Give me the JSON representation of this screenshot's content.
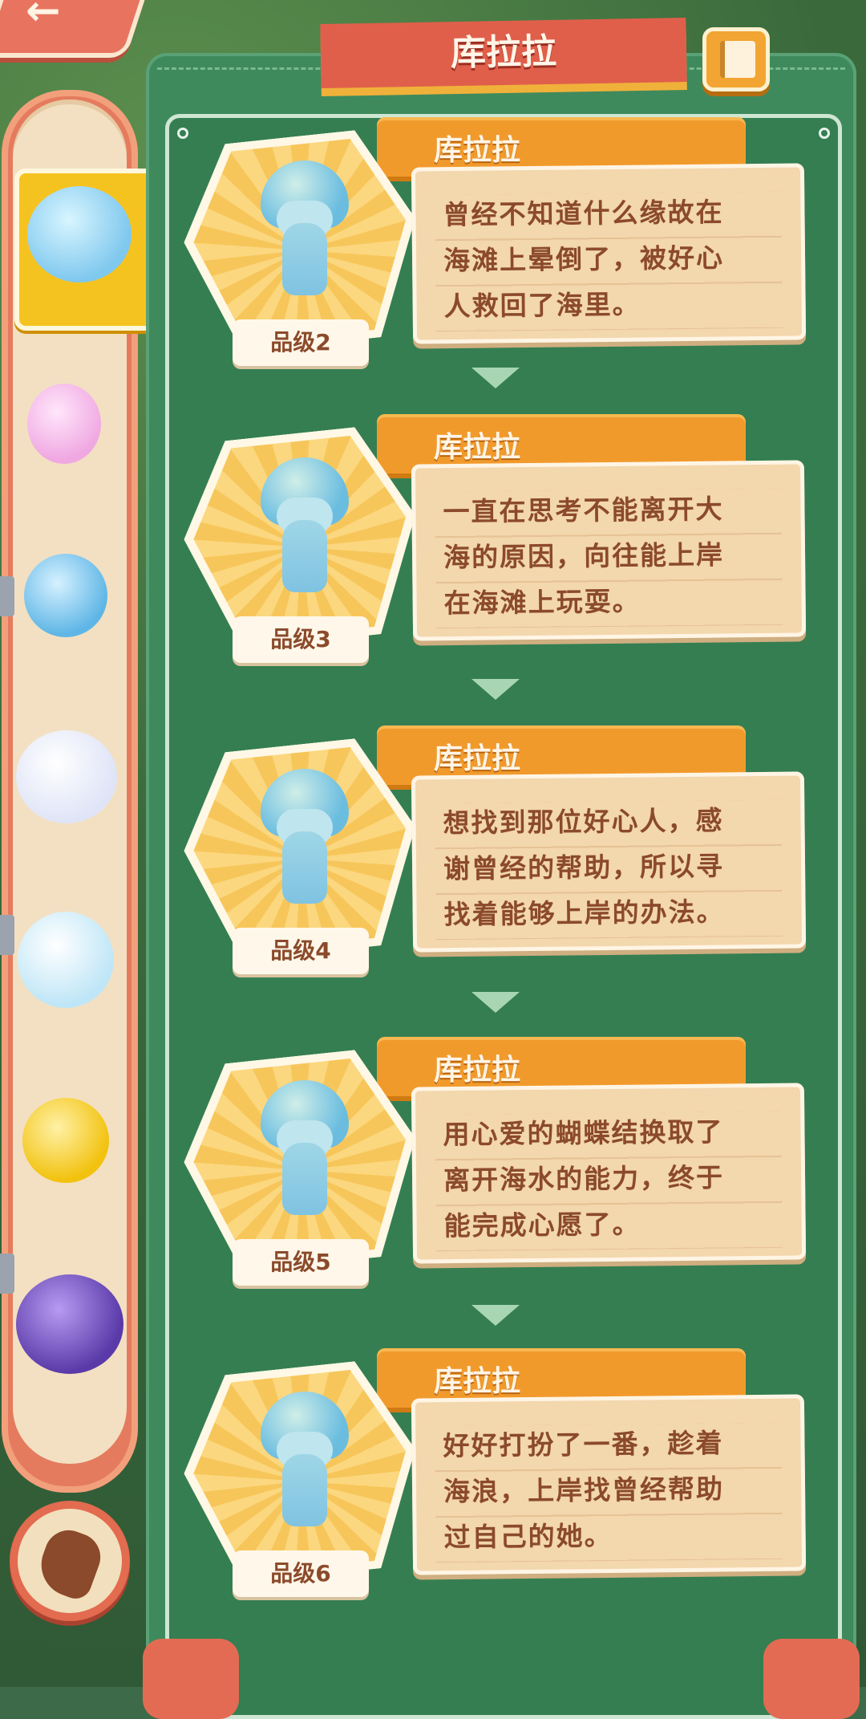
{
  "title": "库拉拉",
  "buttons": {
    "back": "back",
    "book": "book",
    "interact": "hand"
  },
  "cards": [
    {
      "name": "库拉拉",
      "grade": "品级2",
      "lines": [
        "曾经不知道什么缘故在",
        "海滩上晕倒了，被好心",
        "人救回了海里。"
      ]
    },
    {
      "name": "库拉拉",
      "grade": "品级3",
      "lines": [
        "一直在思考不能离开大",
        "海的原因，向往能上岸",
        "在海滩上玩耍。"
      ]
    },
    {
      "name": "库拉拉",
      "grade": "品级4",
      "lines": [
        "想找到那位好心人，感",
        "谢曾经的帮助，所以寻",
        "找着能够上岸的办法。"
      ]
    },
    {
      "name": "库拉拉",
      "grade": "品级5",
      "lines": [
        "用心爱的蝴蝶结换取了",
        "离开海水的能力，终于",
        "能完成心愿了。"
      ]
    },
    {
      "name": "库拉拉",
      "grade": "品级6",
      "lines": [
        "好好打扮了一番，趁着",
        "海浪，上岸找曾经帮助",
        "过自己的她。"
      ]
    }
  ],
  "side_pets": [
    {
      "icon": "jellyfish-pet-icon",
      "color": "#8fd3f0"
    },
    {
      "icon": "pink-dragon-pet-icon",
      "color": "#f6b6e6"
    },
    {
      "icon": "blue-seahorse-pet-icon",
      "color": "#7cc7ea"
    },
    {
      "icon": "winged-ghost-pet-icon",
      "color": "#eef0ff"
    },
    {
      "icon": "antler-spirit-pet-icon",
      "color": "#cdeefa"
    },
    {
      "icon": "yellow-duck-pet-icon",
      "color": "#f5cf2c"
    },
    {
      "icon": "purple-cat-pet-icon",
      "color": "#7a56c9"
    }
  ],
  "colors": {
    "panel": "#3f8a5d",
    "banner": "#e05f4b",
    "name_tab": "#f19a2c",
    "desc_text": "#8b4a2b"
  }
}
